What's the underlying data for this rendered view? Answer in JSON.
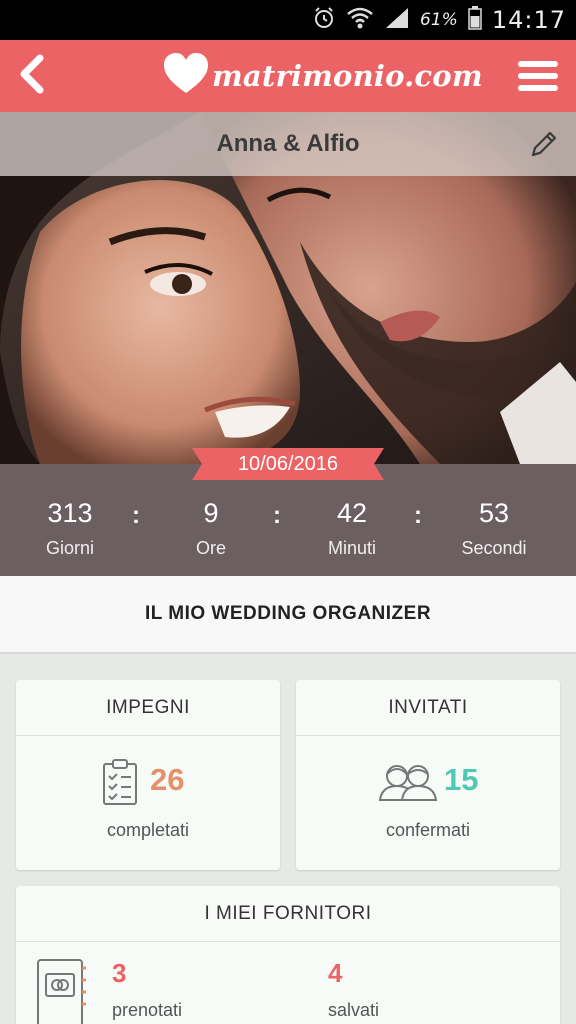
{
  "status_bar": {
    "battery_percent": "61%",
    "time": "14:17"
  },
  "header": {
    "logo_text": "matrimonio.com",
    "back_icon": "chevron-left-icon",
    "menu_icon": "hamburger-icon",
    "color": "#ec6366"
  },
  "hero": {
    "couple_name": "Anna & Alfio",
    "edit_icon": "pencil-icon"
  },
  "countdown": {
    "date": "10/06/2016",
    "units": [
      {
        "value": "313",
        "label": "Giorni"
      },
      {
        "value": "9",
        "label": "Ore"
      },
      {
        "value": "42",
        "label": "Minuti"
      },
      {
        "value": "53",
        "label": "Secondi"
      }
    ],
    "separator": ":"
  },
  "organizer": {
    "title": "IL MIO WEDDING ORGANIZER"
  },
  "cards": {
    "impegni": {
      "title": "IMPEGNI",
      "value": "26",
      "label": "completati",
      "icon": "clipboard-checklist-icon",
      "color": "#e5906a"
    },
    "invitati": {
      "title": "INVITATI",
      "value": "15",
      "label": "confermati",
      "icon": "guests-icon",
      "color": "#4fc9b4"
    },
    "fornitori": {
      "title": "I MIEI FORNITORI",
      "icon": "address-book-icon",
      "booked": {
        "value": "3",
        "label": "prenotati"
      },
      "saved": {
        "value": "4",
        "label": "salvati"
      },
      "color": "#ec6366"
    }
  }
}
